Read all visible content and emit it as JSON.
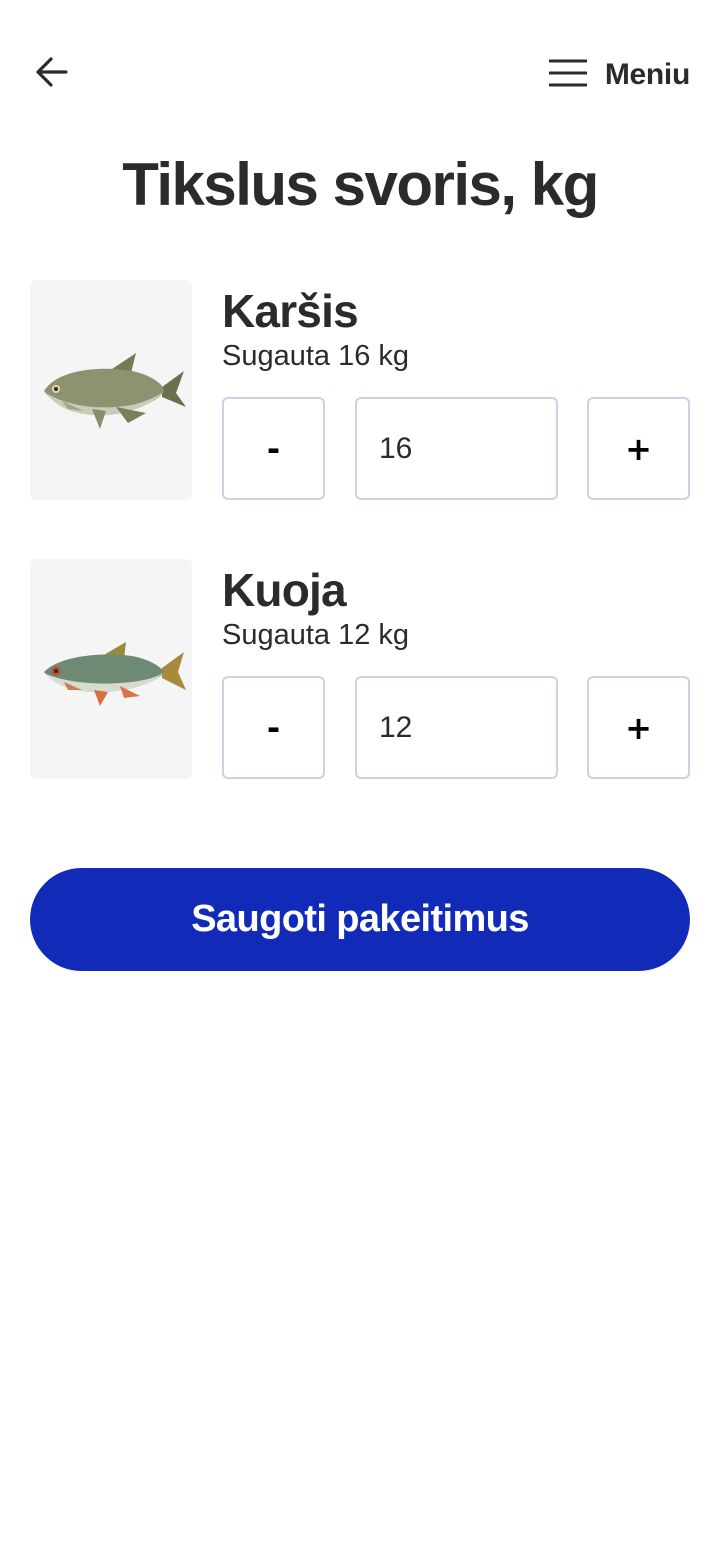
{
  "header": {
    "back_icon": "arrow-left-icon",
    "menu_icon": "hamburger-icon",
    "menu_label": "Meniu"
  },
  "page_title": "Tikslus svoris, kg",
  "fish": [
    {
      "name": "Karšis",
      "caught_prefix": "Sugauta",
      "caught_value": "16 kg",
      "minus_label": "-",
      "weight_value": "16",
      "plus_label": "+",
      "image": "bream-fish-image"
    },
    {
      "name": "Kuoja",
      "caught_prefix": "Sugauta",
      "caught_value": "12 kg",
      "minus_label": "-",
      "weight_value": "12",
      "plus_label": "+",
      "image": "roach-fish-image"
    }
  ],
  "save_label": "Saugoti pakeitimus",
  "colors": {
    "primary": "#112bb8",
    "text": "#2b2b2b",
    "input_border": "#c8d3e4",
    "image_bg": "#f5f5f5"
  }
}
